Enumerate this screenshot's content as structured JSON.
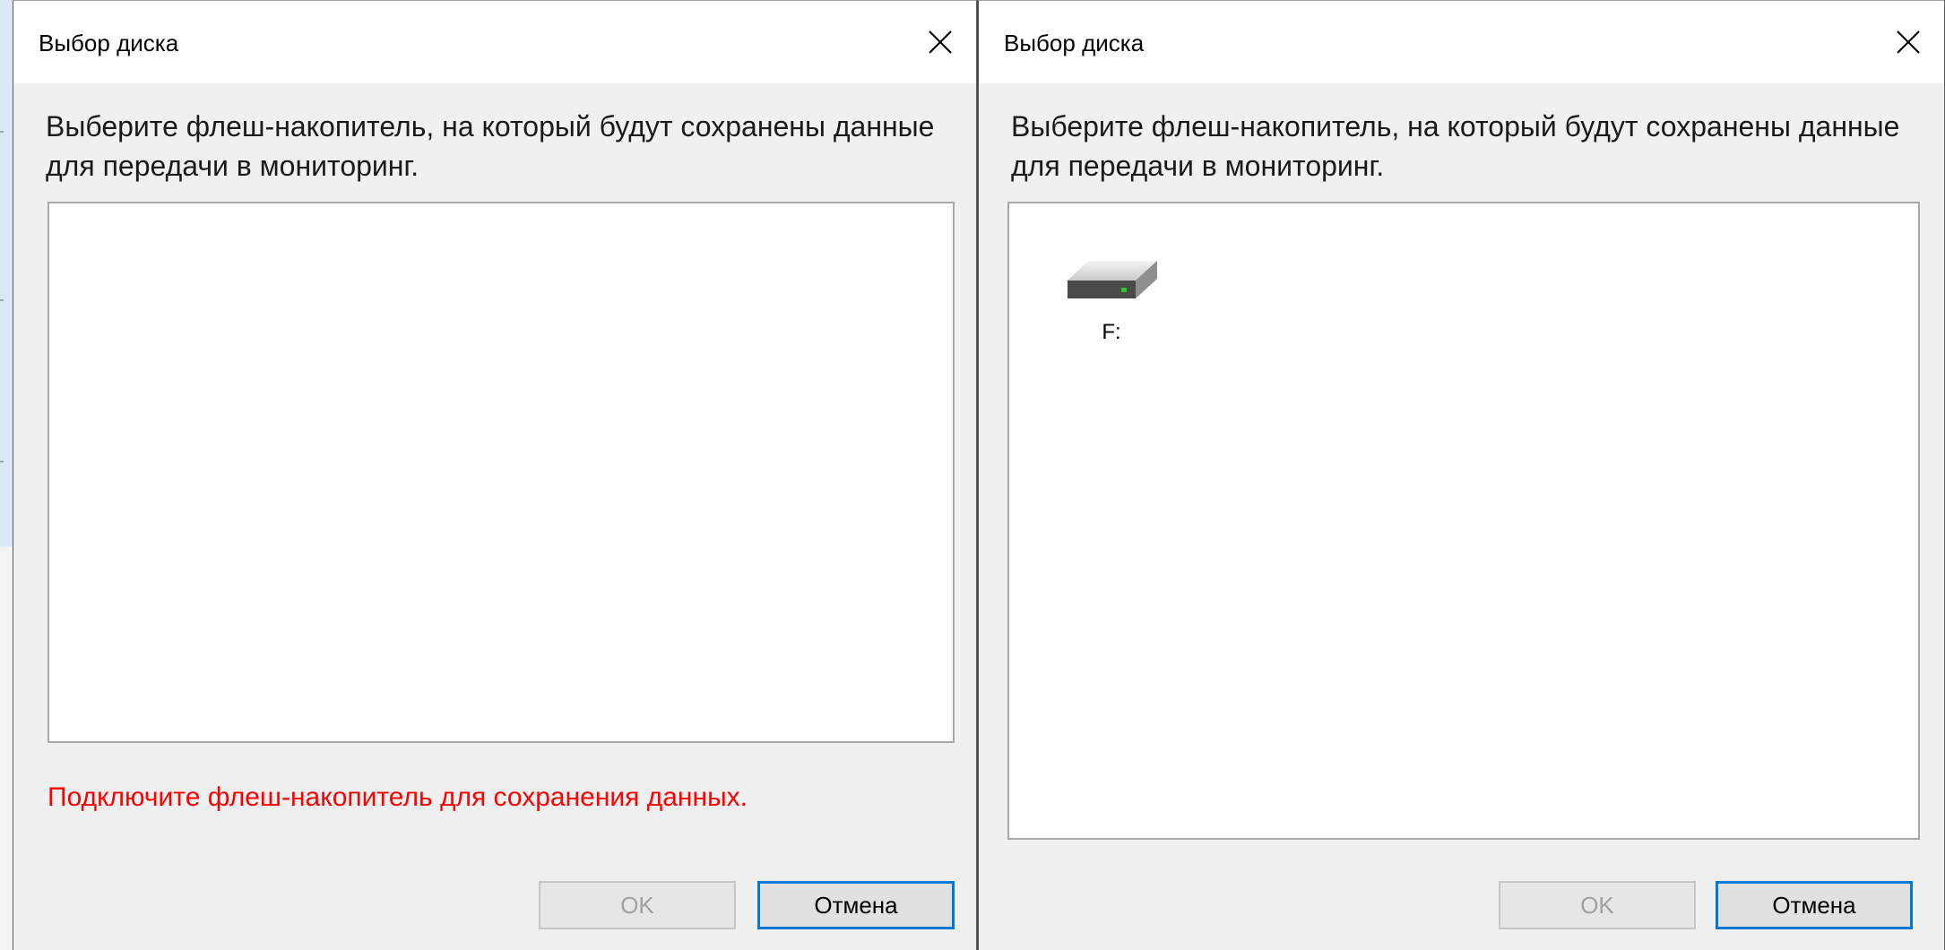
{
  "dialogs": [
    {
      "title": "Выбор диска",
      "instruction": "Выберите флеш-накопитель, на который будут сохранены данные для передачи в мониторинг.",
      "drives": [],
      "error_message": "Подключите флеш-накопитель для сохранения данных.",
      "ok_label": "OK",
      "ok_enabled": false,
      "cancel_label": "Отмена",
      "icons": {
        "close": "close-icon"
      }
    },
    {
      "title": "Выбор диска",
      "instruction": "Выберите флеш-накопитель, на который будут сохранены данные для передачи в мониторинг.",
      "drives": [
        {
          "label": "F:",
          "icon": "usb-drive-icon"
        }
      ],
      "error_message": "",
      "ok_label": "OK",
      "ok_enabled": false,
      "cancel_label": "Отмена",
      "icons": {
        "close": "close-icon"
      }
    }
  ],
  "colors": {
    "error": "#ff0000",
    "focus_border": "#0078d7",
    "dialog_bg": "#f0f0f0",
    "drive_led": "#22cc22"
  }
}
